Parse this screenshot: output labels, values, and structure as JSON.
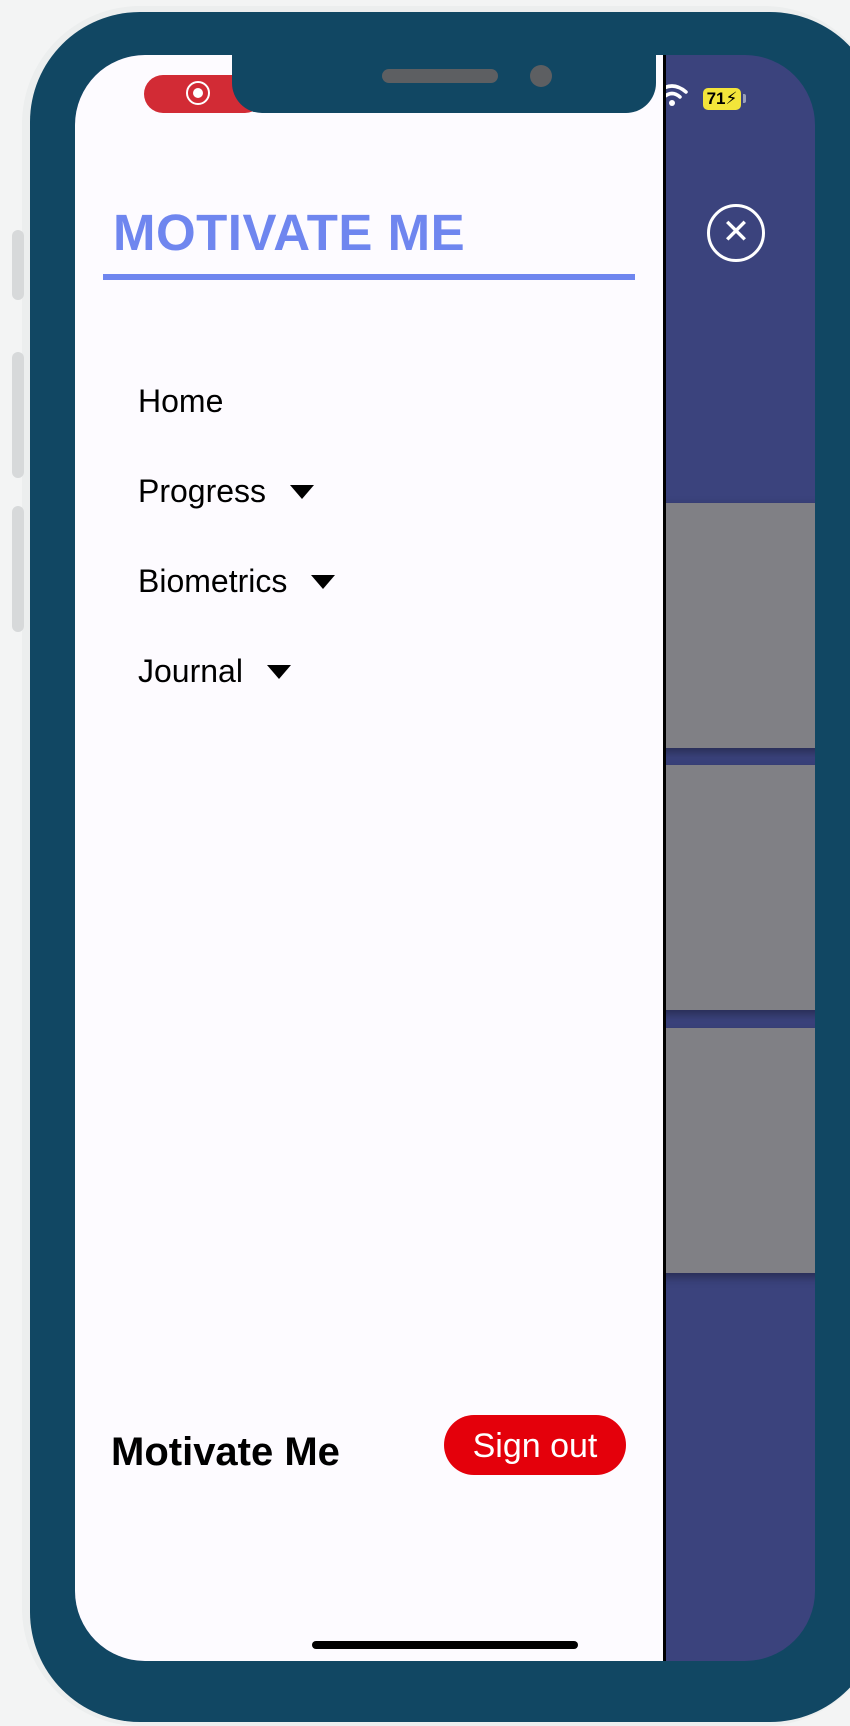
{
  "app": {
    "title": "MOTIVATE ME",
    "footer_title": "Motivate Me",
    "sign_out_label": "Sign out"
  },
  "status_bar": {
    "battery": "71",
    "charging_icon": "bolt-icon",
    "wifi_icon": "wifi-icon",
    "recording_icon": "screen-record-icon"
  },
  "nav": {
    "items": [
      {
        "label": "Home",
        "has_dropdown": false
      },
      {
        "label": "Progress",
        "has_dropdown": true
      },
      {
        "label": "Biometrics",
        "has_dropdown": true
      },
      {
        "label": "Journal",
        "has_dropdown": true
      }
    ]
  },
  "overlay": {
    "close_icon": "close-circle-icon",
    "close_glyph": "✕"
  },
  "colors": {
    "accent": "#6f86ef",
    "danger": "#e4000b",
    "device_frame": "#114763",
    "background_panel": "#3b437d",
    "card": "#808085"
  }
}
